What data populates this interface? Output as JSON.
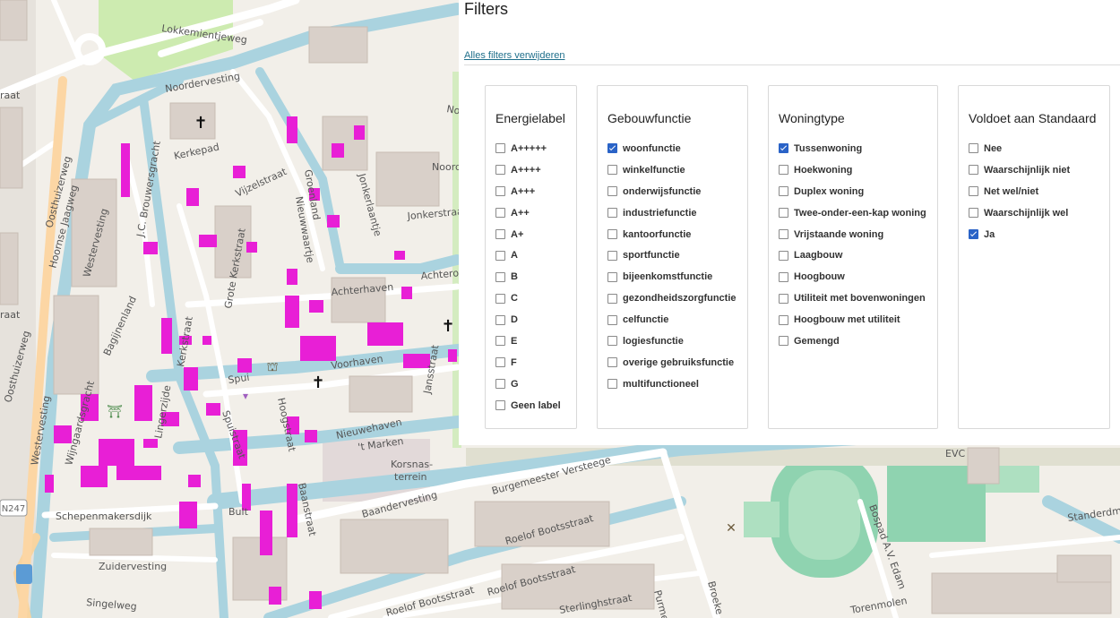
{
  "panel": {
    "title": "Filters",
    "clear_all": "Alles filters verwijderen"
  },
  "groups": [
    {
      "title": "Energielabel",
      "options": [
        {
          "label": "A+++++",
          "checked": false
        },
        {
          "label": "A++++",
          "checked": false
        },
        {
          "label": "A+++",
          "checked": false
        },
        {
          "label": "A++",
          "checked": false
        },
        {
          "label": "A+",
          "checked": false
        },
        {
          "label": "A",
          "checked": false
        },
        {
          "label": "B",
          "checked": false
        },
        {
          "label": "C",
          "checked": false
        },
        {
          "label": "D",
          "checked": false
        },
        {
          "label": "E",
          "checked": false
        },
        {
          "label": "F",
          "checked": false
        },
        {
          "label": "G",
          "checked": false
        },
        {
          "label": "Geen label",
          "checked": false
        }
      ]
    },
    {
      "title": "Gebouwfunctie",
      "options": [
        {
          "label": "woonfunctie",
          "checked": true
        },
        {
          "label": "winkelfunctie",
          "checked": false
        },
        {
          "label": "onderwijsfunctie",
          "checked": false
        },
        {
          "label": "industriefunctie",
          "checked": false
        },
        {
          "label": "kantoorfunctie",
          "checked": false
        },
        {
          "label": "sportfunctie",
          "checked": false
        },
        {
          "label": "bijeenkomstfunctie",
          "checked": false
        },
        {
          "label": "gezondheidszorgfunctie",
          "checked": false
        },
        {
          "label": "celfunctie",
          "checked": false
        },
        {
          "label": "logiesfunctie",
          "checked": false
        },
        {
          "label": "overige gebruiksfunctie",
          "checked": false
        },
        {
          "label": "multifunctioneel",
          "checked": false
        }
      ]
    },
    {
      "title": "Woningtype",
      "options": [
        {
          "label": "Tussenwoning",
          "checked": true
        },
        {
          "label": "Hoekwoning",
          "checked": false
        },
        {
          "label": "Duplex woning",
          "checked": false
        },
        {
          "label": "Twee-onder-een-kap woning",
          "checked": false
        },
        {
          "label": "Vrijstaande woning",
          "checked": false
        },
        {
          "label": "Laagbouw",
          "checked": false
        },
        {
          "label": "Hoogbouw",
          "checked": false
        },
        {
          "label": "Utiliteit met bovenwoningen",
          "checked": false
        },
        {
          "label": "Hoogbouw met utiliteit",
          "checked": false
        },
        {
          "label": "Gemengd",
          "checked": false
        }
      ]
    },
    {
      "title": "Voldoet aan Standaard",
      "options": [
        {
          "label": "Nee",
          "checked": false
        },
        {
          "label": "Waarschijnlijk niet",
          "checked": false
        },
        {
          "label": "Net wel/niet",
          "checked": false
        },
        {
          "label": "Waarschijnlijk wel",
          "checked": false
        },
        {
          "label": "Ja",
          "checked": true
        }
      ]
    }
  ],
  "map": {
    "highlight_color": "#e81fd6",
    "street_labels": {
      "lokkemientjeweg": "Lokkemientjeweg",
      "noordervesting": "Noordervesting",
      "kerkepad": "Kerkepad",
      "vijzelstraat": "Vijzelstraat",
      "groenland": "Groenland",
      "nieuwwaartje": "Nieuwwaartje",
      "jonkerlaantje": "Jonkerlaantje",
      "jonkerstraat": "Jonkerstraat",
      "achterhaven": "Achterhaven",
      "achterom": "Achterom",
      "grote_kerkstraat": "Grote Kerkstraat",
      "voorhaven": "Voorhaven",
      "spui": "Spui",
      "nieuwehaven": "Nieuwehaven",
      "t_marken": "'t Marken",
      "korsnas": "Korsnas-",
      "terrein": "terrein",
      "baandervesting": "Baandervesting",
      "burgemeester": "Burgemeester Versteege",
      "schepenmakersdijk": "Schepenmakersdijk",
      "zuidervesting": "Zuidervesting",
      "singelweg": "Singelweg",
      "roelof1": "Roelof Bootsstraat",
      "roelof2": "Roelof Bootsstraat",
      "roelof3": "Roelof Bootsstraat",
      "hoornse_jaagweg": "Hoornse Jaagweg",
      "westervesting": "Westervesting",
      "westerveste": "Westervesting",
      "oosthuizerweg": "Oosthuizerweg",
      "oosthuizerweg2": "Oosthuizerweg",
      "bagijnenland": "Bagijnenland",
      "wijngaardsgracht": "Wijngaardsgracht",
      "lingerzijde": "Lingerzijde",
      "bult": "Bult",
      "hoogstraat": "Hoogstraat",
      "baanstraat": "Baanstraat",
      "kerkstraat2": "Kerkstraat",
      "jansstraat": "Jansstraat",
      "bospad": "Bospad A.V. Edam",
      "torenmolen": "Torenmolen",
      "standerdmolen": "Standerdm",
      "evc": "EVC",
      "purmer": "Purmers",
      "broeker": "Broeke",
      "noord": "Noord",
      "noorder": "No",
      "raat": "raat",
      "raat2": "raat",
      "sterlinghstraat": "Sterlinghstraat",
      "road": "N247",
      "brouwersgracht": "J.C. Brouwersgracht",
      "spuistraat": "Spuistraat",
      "ling": "Lingerzijde",
      "kerkstr3": "Kerkstraat"
    }
  }
}
